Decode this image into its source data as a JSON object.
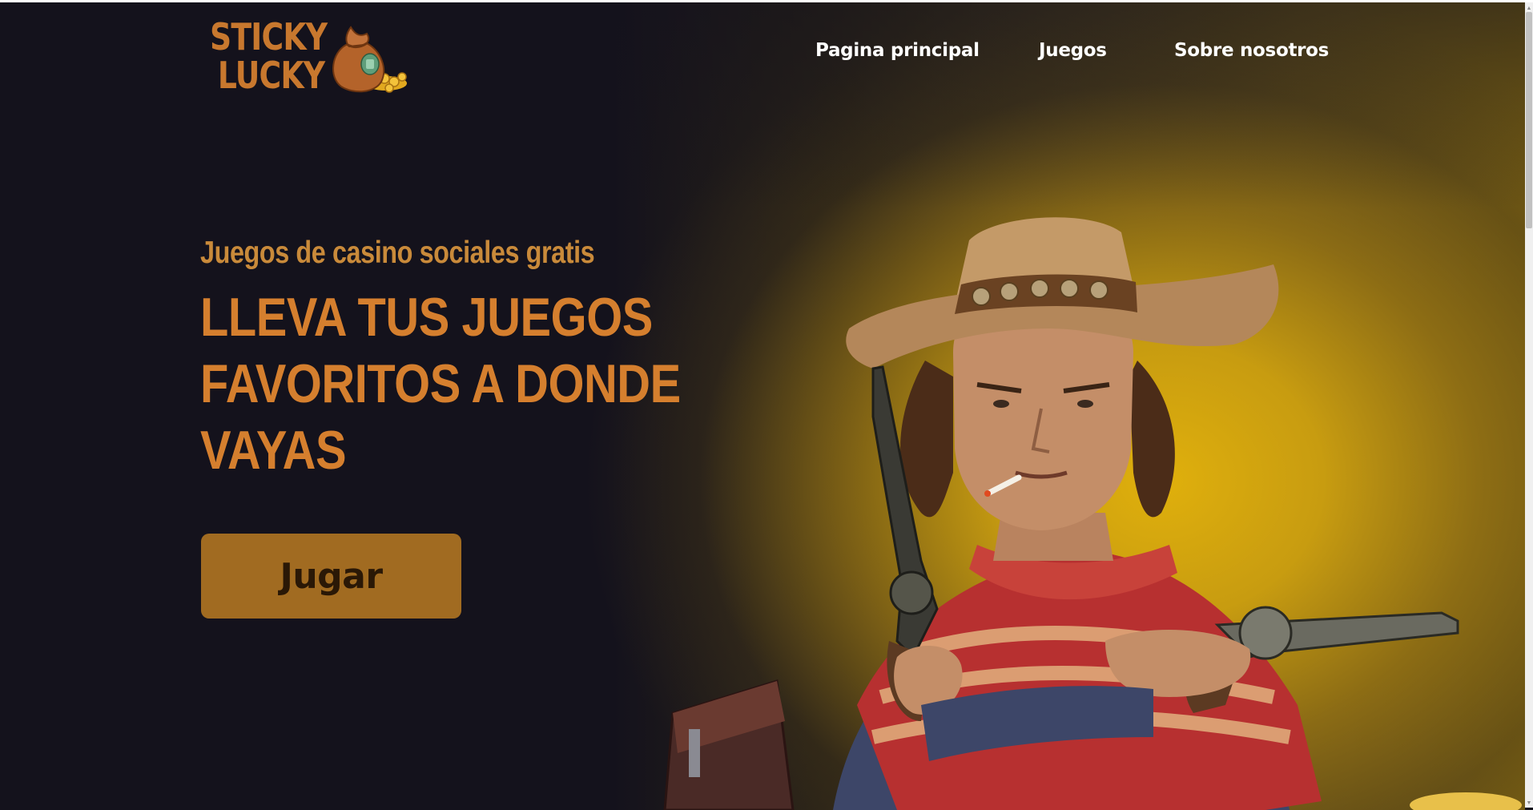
{
  "header": {
    "logo": {
      "line1": "STICKY",
      "line2": "LUCKY",
      "icon": "money-bag-icon"
    },
    "nav": [
      {
        "label": "Pagina principal"
      },
      {
        "label": "Juegos"
      },
      {
        "label": "Sobre nosotros"
      }
    ]
  },
  "hero": {
    "subtitle": "Juegos de casino sociales gratis",
    "headline_lines": [
      "LLEVA TUS JUEGOS",
      "FAVORITOS A DONDE",
      "VAYAS"
    ],
    "cta_label": "Jugar",
    "illustration": "cowboy-gunslinger-illustration"
  },
  "colors": {
    "accent": "#d57f2e",
    "subtitle": "#c98a3a",
    "button_bg": "#a16b21",
    "button_text": "#2a1806",
    "background": "#14121c",
    "glow": "#e0b00c"
  }
}
